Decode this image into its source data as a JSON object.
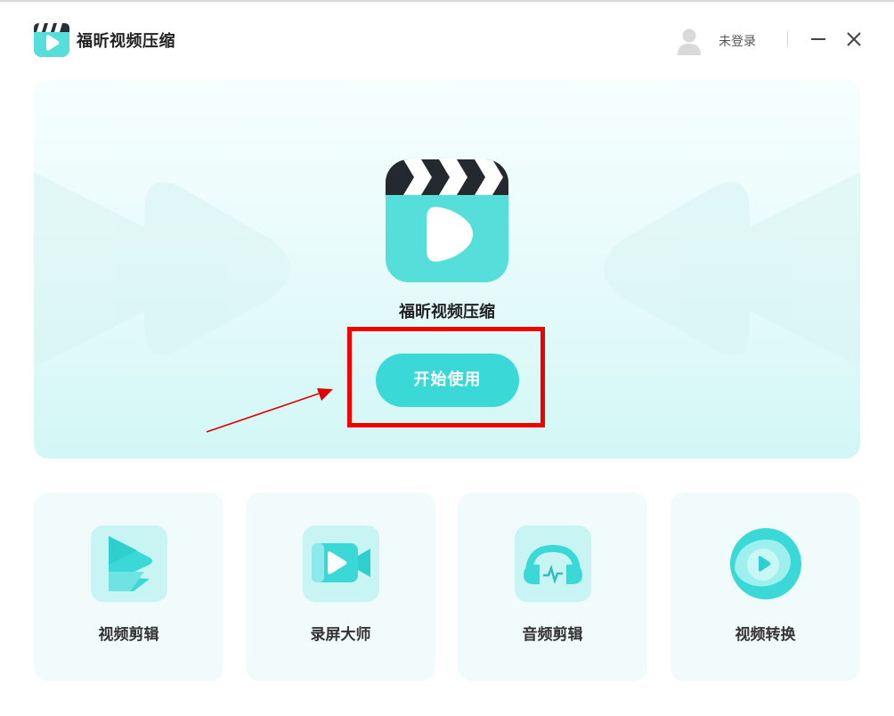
{
  "app": {
    "title": "福昕视频压缩",
    "user": {
      "login_label": "未登录"
    },
    "window_controls": {
      "minimize_icon": "minimize-icon",
      "close_icon": "close-icon"
    }
  },
  "hero": {
    "title": "福昕视频压缩",
    "start_button": "开始使用",
    "logo_icon": "clapperboard-play-icon"
  },
  "features": [
    {
      "label": "视频剪辑",
      "icon": "video-edit-icon"
    },
    {
      "label": "录屏大师",
      "icon": "screen-record-icon"
    },
    {
      "label": "音频剪辑",
      "icon": "audio-edit-icon"
    },
    {
      "label": "视频转换",
      "icon": "video-convert-icon"
    }
  ],
  "colors": {
    "accent": "#3ad9d8",
    "logo_teal": "#55deda",
    "annotation_red": "#f20000",
    "card_bg": "#f2fbfb"
  }
}
